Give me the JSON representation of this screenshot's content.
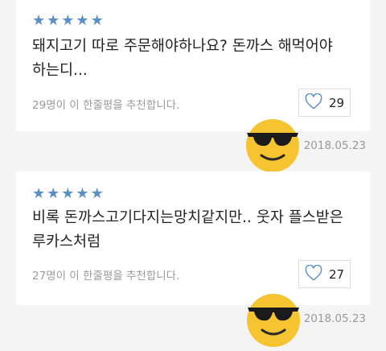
{
  "reviews": [
    {
      "rating": 5,
      "text": "돼지고기 따로 주문해야하나요? 돈까스 해먹어야 하는디...",
      "recommend_text": "29명이 이 한줄평을 추천합니다.",
      "likes": "29",
      "date": "2018.05.23",
      "emoji": "sunglasses-emoji"
    },
    {
      "rating": 5,
      "text": "비록 돈까스고기다지는망치같지만.. 웃자 플스받은 루카스처럼",
      "recommend_text": "27명이 이 한줄평을 추천합니다.",
      "likes": "27",
      "date": "2018.05.23",
      "emoji": "sunglasses-emoji"
    }
  ],
  "icons": {
    "star": "star-icon",
    "like": "heart-outline-icon"
  },
  "colors": {
    "star": "#5a8ec8",
    "heart": "#5a8ec8",
    "emoji": "#f6c431"
  }
}
